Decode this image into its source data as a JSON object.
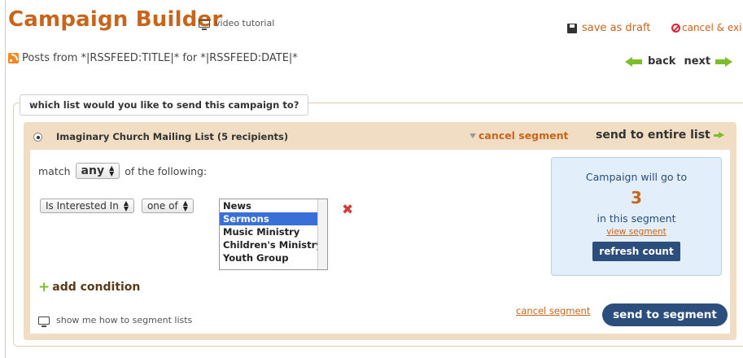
{
  "header": {
    "title": "Campaign Builder",
    "video_tutorial": "video tutorial",
    "save_draft": "save as draft",
    "cancel_exit": "cancel & exi"
  },
  "subheader": {
    "posts_line": "Posts from *|RSSFEED:TITLE|* for *|RSSFEED:DATE|*",
    "back": "back",
    "next": "next"
  },
  "section": {
    "question": "which list would you like to send this campaign to?"
  },
  "list": {
    "name": "Imaginary Church Mailing List (5 recipients)",
    "cancel_segment": "cancel segment",
    "send_entire": "send to entire list"
  },
  "segment": {
    "match_prefix": "match",
    "match_value": "any",
    "match_suffix": "of the following:",
    "field_select": "Is Interested In",
    "operator_select": "one of",
    "options": [
      "News",
      "Sermons",
      "Music Ministry",
      "Children's Ministry",
      "Youth Group"
    ],
    "selected_option": "Sermons",
    "add_condition": "add condition",
    "howto": "show me how to segment lists",
    "cancel_segment_link": "cancel segment",
    "send_to_segment": "send to segment"
  },
  "count_box": {
    "label_top": "Campaign will go to",
    "count": "3",
    "label_bottom": "in this segment",
    "view_segment": "view segment",
    "refresh": "refresh count"
  },
  "colors": {
    "accent_orange": "#c8651b",
    "navy_button": "#2b4e7c",
    "panel_tan": "#f1ddc3",
    "info_blue": "#e2eefa",
    "green_arrow": "#7cbd2c"
  }
}
